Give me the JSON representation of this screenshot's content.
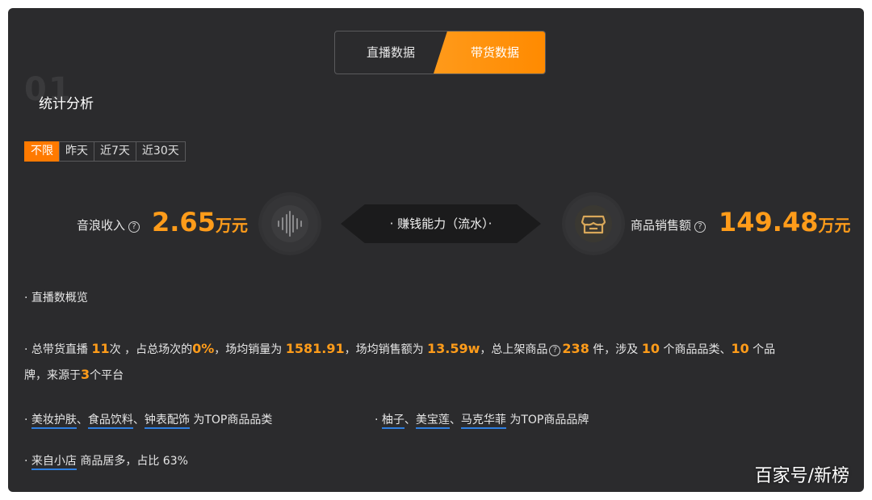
{
  "tabs": {
    "live": "直播数据",
    "goods": "带货数据"
  },
  "section": {
    "number": "01",
    "title": "统计分析"
  },
  "filters": [
    "不限",
    "昨天",
    "近7天",
    "近30天"
  ],
  "metrics": {
    "sound_wave_label": "音浪收入",
    "sound_wave_value": "2.65",
    "sound_wave_unit": "万元",
    "earn_banner": "· 赚钱能力（流水）·",
    "sales_label": "商品销售额",
    "sales_value": "149.48",
    "sales_unit": "万元"
  },
  "overview_title": "· 直播数概览",
  "summary": {
    "p1": "· 总带货直播",
    "live_count": "11",
    "p2": "次 ，占总场次的",
    "percent": "0%",
    "p3": "，场均销量为",
    "avg_sales": "1581.91",
    "p4": "，场均销售额为",
    "avg_amount": "13.59w",
    "p5": "，总上架商品",
    "total_goods": "238",
    "p6": "件，涉及",
    "categories": "10",
    "p7": "个商品品类、",
    "brands": "10",
    "p8": "个品",
    "p9": "牌，来源于",
    "platforms": "3",
    "p10": "个平台"
  },
  "top_categories": {
    "prefix": "· ",
    "items": [
      "美妆护肤",
      "食品饮料",
      "钟表配饰"
    ],
    "sep": "、",
    "suffix": "为TOP商品品类"
  },
  "top_brands": {
    "prefix": "· ",
    "items": [
      "柚子",
      "美宝莲",
      "马克华菲"
    ],
    "sep": "、",
    "suffix": "为TOP商品品牌"
  },
  "source": {
    "prefix": "· ",
    "store": "来自小店",
    "text": " 商品居多，占比 63%"
  },
  "watermark": "百家号/新榜",
  "colors": {
    "accent": "#ff9c1a",
    "panel": "#2b2b2d",
    "underline": "#2f7fe0"
  }
}
